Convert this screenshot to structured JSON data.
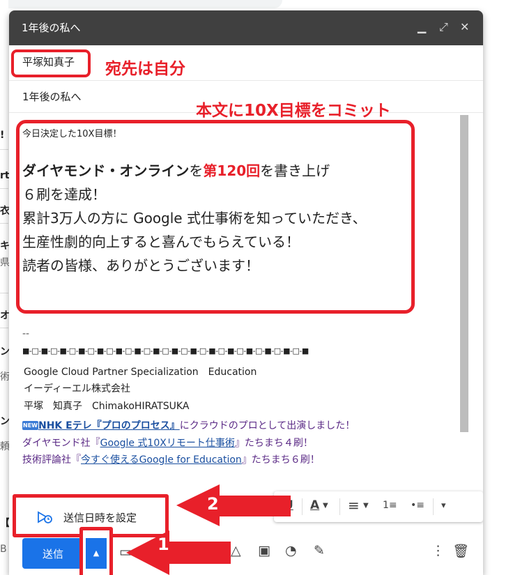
{
  "background": {
    "edge_fragments": [
      "!",
      "rt",
      "衣",
      "キ",
      "県",
      "オ",
      "ン",
      "術",
      "ン",
      "頼",
      "【",
      "B"
    ]
  },
  "window": {
    "title": "1年後の私へ",
    "controls": {
      "minimize": "▁",
      "expand": "⤢",
      "close": "✕"
    }
  },
  "recipient": {
    "chip": "平塚知真子"
  },
  "annotations": {
    "to_self": "宛先は自分",
    "commit": "本文に10X目標をコミット",
    "step1": "1",
    "step2": "2"
  },
  "subject": "1年後の私へ",
  "body": {
    "intro": "今日決定した10X目標！",
    "line1_bold": "ダイヤモンド・オンライン",
    "line1_mid": "を",
    "line1_red": "第120回",
    "line1_end": "を書き上げ",
    "line2": "６刷を達成！",
    "line3": "累計3万人の方に Google 式仕事術を知っていただき、",
    "line4": "生産性劇的向上すると喜んでもらえている！",
    "line5": "読者の皆様、ありがとうございます！"
  },
  "signature": {
    "dash": "--",
    "pattern": "■-□-■-□-■-□-■-□-■-□-■-□-■-□-■-□-■-□-■-□-■-□-■-□-■-□-■-□-■-□-■",
    "line1": "Google Cloud Partner Specialization　Education",
    "line2": "イーディーエル株式会社",
    "line3": "平塚　知真子　ChimakoHIRATSUKA",
    "new_badge": "NEW",
    "promo1_link": "NHK Eテレ『プロのプロセス』",
    "promo1_rest": "にクラウドのプロとして出演しました！",
    "promo2_pre": "ダイヤモンド社『",
    "promo2_link": "Google 式10Xリモート仕事術",
    "promo2_rest": "』たちまち４刷！",
    "promo3_pre": "技術評論社『",
    "promo3_link": "今すぐ使えるGoogle for Education",
    "promo3_rest": "』たちまち６刷！"
  },
  "format_toolbar": {
    "underline": "U",
    "text_color": "A",
    "align": "≡",
    "numbered": "1≡",
    "bulleted": "•≡",
    "more": "▾"
  },
  "schedule_popup": {
    "label": "送信日時を設定"
  },
  "footer": {
    "send": "送信",
    "send_options": "▲"
  }
}
